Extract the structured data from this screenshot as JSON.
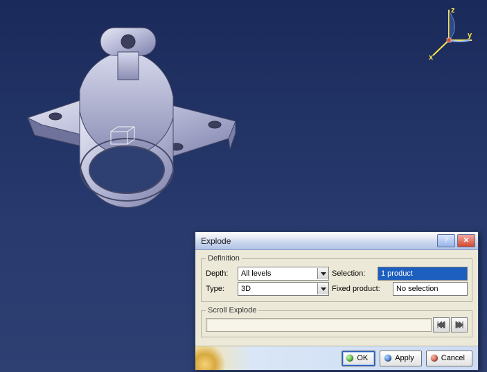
{
  "compass": {
    "x_label": "x",
    "y_label": "y",
    "z_label": "z"
  },
  "dialog": {
    "title": "Explode",
    "groups": {
      "definition_legend": "Definition",
      "scroll_legend": "Scroll Explode"
    },
    "labels": {
      "depth": "Depth:",
      "type": "Type:",
      "selection": "Selection:",
      "fixed_product": "Fixed product:"
    },
    "values": {
      "depth": "All levels",
      "type": "3D",
      "selection": "1 product",
      "fixed_product": "No selection"
    },
    "buttons": {
      "ok": "OK",
      "apply": "Apply",
      "cancel": "Cancel"
    },
    "scroll": {
      "first": "|◀◀",
      "last": "▶▶|"
    },
    "title_buttons": {
      "help": "?",
      "close": "✕"
    }
  },
  "chart_data": {
    "type": "table",
    "title": "Explode dialog parameters",
    "rows": [
      {
        "field": "Depth",
        "value": "All levels"
      },
      {
        "field": "Type",
        "value": "3D"
      },
      {
        "field": "Selection",
        "value": "1 product"
      },
      {
        "field": "Fixed product",
        "value": "No selection"
      }
    ]
  }
}
